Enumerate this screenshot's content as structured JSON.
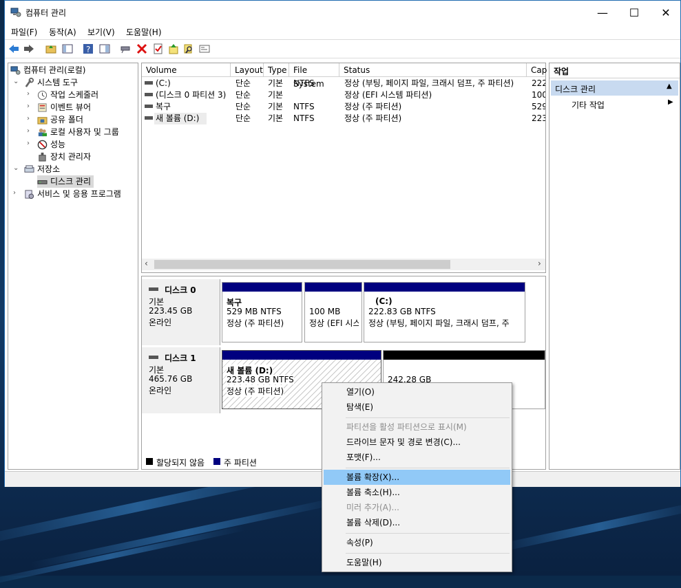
{
  "window": {
    "title": "컴퓨터 관리",
    "controls": {
      "minimize": "—",
      "maximize": "☐",
      "close": "✕"
    }
  },
  "menubar": [
    "파일(F)",
    "동작(A)",
    "보기(V)",
    "도움말(H)"
  ],
  "toolbar_icons": [
    "back-icon",
    "forward-icon",
    "up-folder-icon",
    "show-hide-tree-icon",
    "help-icon",
    "properties-pane-icon",
    "connect-icon",
    "delete-icon",
    "check-icon",
    "import-icon",
    "search-icon",
    "console-icon"
  ],
  "tree": {
    "root": "컴퓨터 관리(로컬)",
    "system_tools": "시스템 도구",
    "task_scheduler": "작업 스케줄러",
    "event_viewer": "이벤트 뷰어",
    "shared_folders": "공유 폴더",
    "local_users": "로컬 사용자 및 그룹",
    "performance": "성능",
    "device_manager": "장치 관리자",
    "storage": "저장소",
    "disk_management": "디스크 관리",
    "services": "서비스 및 응용 프로그램"
  },
  "volume_list": {
    "columns": [
      "Volume",
      "Layout",
      "Type",
      "File System",
      "Status",
      "Cap"
    ],
    "rows": [
      {
        "volume": "(C:)",
        "layout": "단순",
        "type": "기본",
        "fs": "NTFS",
        "status": "정상 (부팅, 페이지 파일, 크래시 덤프, 주 파티션)",
        "cap": "222"
      },
      {
        "volume": "(디스크 0 파티션 3)",
        "layout": "단순",
        "type": "기본",
        "fs": "",
        "status": "정상 (EFI 시스템 파티션)",
        "cap": "100"
      },
      {
        "volume": "복구",
        "layout": "단순",
        "type": "기본",
        "fs": "NTFS",
        "status": "정상 (주 파티션)",
        "cap": "529"
      },
      {
        "volume": "새 볼륨 (D:)",
        "layout": "단순",
        "type": "기본",
        "fs": "NTFS",
        "status": "정상 (주 파티션)",
        "cap": "223"
      }
    ]
  },
  "disks": [
    {
      "name": "디스크 0",
      "type": "기본",
      "size": "223.45 GB",
      "state": "온라인",
      "partitions": [
        {
          "title": "복구",
          "size": "529 MB NTFS",
          "status": "정상 (주 파티션)"
        },
        {
          "title": "",
          "size": "100 MB",
          "status": "정상 (EFI 시스"
        },
        {
          "title": "(C:)",
          "size": "222.83 GB NTFS",
          "status": "정상 (부팅, 페이지 파일, 크래시 덤프, 주"
        }
      ]
    },
    {
      "name": "디스크 1",
      "type": "기본",
      "size": "465.76 GB",
      "state": "온라인",
      "partitions": [
        {
          "title": "새 볼륨  (D:)",
          "size": "223.48 GB NTFS",
          "status": "정상 (주 파티션)"
        },
        {
          "title": "",
          "size": "242.28 GB",
          "status": ""
        }
      ]
    }
  ],
  "legend": {
    "unallocated": "할당되지 않음",
    "primary": "주 파티션"
  },
  "actions": {
    "header": "작업",
    "section": "디스크 관리",
    "more": "기타 작업"
  },
  "context_menu": {
    "items": [
      {
        "label": "열기(O)",
        "enabled": true
      },
      {
        "label": "탐색(E)",
        "enabled": true
      },
      {
        "label": "파티션을 활성 파티션으로 표시(M)",
        "enabled": false
      },
      {
        "label": "드라이브 문자 및 경로 변경(C)...",
        "enabled": true
      },
      {
        "label": "포맷(F)...",
        "enabled": true
      },
      {
        "label": "볼륨 확장(X)...",
        "enabled": true,
        "highlighted": true
      },
      {
        "label": "볼륨 축소(H)...",
        "enabled": true
      },
      {
        "label": "미러 추가(A)...",
        "enabled": false
      },
      {
        "label": "볼륨 삭제(D)...",
        "enabled": true
      },
      {
        "label": "속성(P)",
        "enabled": true
      },
      {
        "label": "도움말(H)",
        "enabled": true
      }
    ]
  },
  "colors": {
    "primary_partition": "#00007f",
    "unallocated": "#000000",
    "menu_highlight": "#91c9f7",
    "selection": "#cce8ff"
  }
}
